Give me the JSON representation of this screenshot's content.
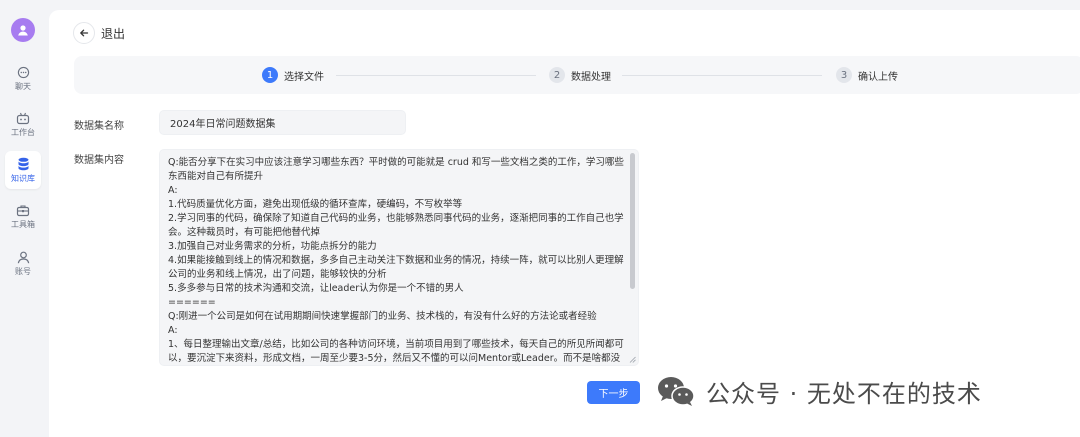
{
  "sidebar": {
    "items": [
      {
        "label": "聊天",
        "icon": "chat-icon"
      },
      {
        "label": "工作台",
        "icon": "robot-icon"
      },
      {
        "label": "知识库",
        "icon": "database-icon",
        "active": true
      },
      {
        "label": "工具箱",
        "icon": "toolbox-icon"
      },
      {
        "label": "账号",
        "icon": "user-icon"
      }
    ]
  },
  "header": {
    "back_label": "退出"
  },
  "steps": [
    {
      "num": "1",
      "label": "选择文件",
      "active": true
    },
    {
      "num": "2",
      "label": "数据处理",
      "active": false
    },
    {
      "num": "3",
      "label": "确认上传",
      "active": false
    }
  ],
  "form": {
    "name_label": "数据集名称",
    "name_value": "2024年日常问题数据集",
    "content_label": "数据集内容",
    "content_value": "Q:能否分享下在实习中应该注意学习哪些东西？平时做的可能就是 crud 和写一些文档之类的工作，学习哪些东西能对自己有所提升\nA:\n1.代码质量优化方面，避免出现低级的循环查库，硬编码，不写枚举等\n2.学习同事的代码，确保除了知道自己代码的业务，也能够熟悉同事代码的业务，逐渐把同事的工作自己也学会。这种裁员时，有可能把他替代掉\n3.加强自己对业务需求的分析，功能点拆分的能力\n4.如果能接触到线上的情况和数据，多多自己主动关注下数据和业务的情况，持续一阵，就可以比别人更理解公司的业务和线上情况，出了问题，能够较快的分析\n5.多多参与日常的技术沟通和交流，让leader认为你是一个不错的男人\n======\nQ:刚进一个公司是如何在试用期期间快速掌握部门的业务、技术栈的，有没有什么好的方法论或者经验\nA:\n1、每日整理输出文章/总结，比如公司的各种访问环境，当前项目用到了哪些技术，每天自己的所见所闻都可以，要沉淀下来资料，形成文档，一周至少要3-5分，然后又不懂的可以问Mentor或Leader。而不是啥都没有去问，而是自己携带自己的梳理结果，去问去沟通"
  },
  "next_button": "下一步",
  "watermark": {
    "text": "公众号 · 无处不在的技术"
  },
  "colors": {
    "accent": "#3d7afb",
    "avatar": "#a77cf0"
  }
}
